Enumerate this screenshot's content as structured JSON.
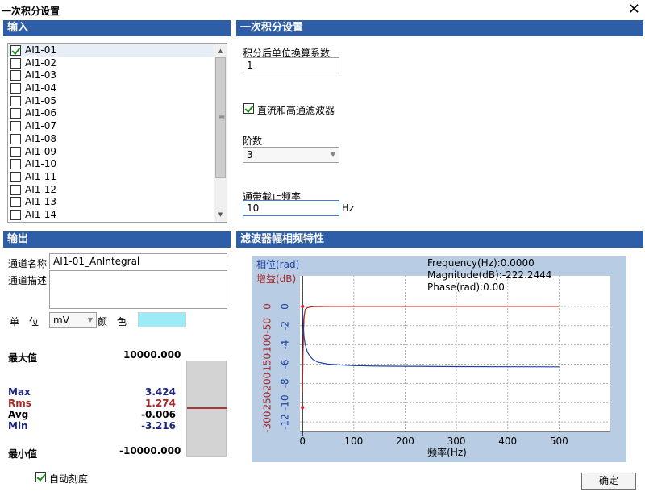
{
  "window": {
    "title": "一次积分设置",
    "close": "✕"
  },
  "input_section": {
    "header": "输入",
    "channels": [
      {
        "label": "AI1-01",
        "checked": true
      },
      {
        "label": "AI1-02",
        "checked": false
      },
      {
        "label": "AI1-03",
        "checked": false
      },
      {
        "label": "AI1-04",
        "checked": false
      },
      {
        "label": "AI1-05",
        "checked": false
      },
      {
        "label": "AI1-06",
        "checked": false
      },
      {
        "label": "AI1-07",
        "checked": false
      },
      {
        "label": "AI1-08",
        "checked": false
      },
      {
        "label": "AI1-09",
        "checked": false
      },
      {
        "label": "AI1-10",
        "checked": false
      },
      {
        "label": "AI1-11",
        "checked": false
      },
      {
        "label": "AI1-12",
        "checked": false
      },
      {
        "label": "AI1-13",
        "checked": false
      },
      {
        "label": "AI1-14",
        "checked": false
      }
    ]
  },
  "settings": {
    "header": "一次积分设置",
    "coef_label": "积分后单位换算系数",
    "coef_value": "1",
    "filter_label": "直流和高通滤波器",
    "filter_checked": true,
    "order_label": "阶数",
    "order_value": "3",
    "cutoff_label": "通带截止频率",
    "cutoff_value": "10",
    "cutoff_unit": "Hz"
  },
  "output": {
    "header": "输出",
    "name_label": "通道名称",
    "name_value": "AI1-01_AnIntegral",
    "desc_label": "通道描述",
    "desc_value": "",
    "unit_label": "单　位",
    "unit_value": "mV",
    "color_label": "颜　色",
    "color_value": "#9cecf8",
    "max_label": "最大值",
    "max_value": "10000.000",
    "min_label": "最小值",
    "min_value": "-10000.000",
    "stats": [
      {
        "label": "Max",
        "value": "3.424",
        "color": "#1a237e"
      },
      {
        "label": "Rms",
        "value": "1.274",
        "color": "#a52a2a"
      },
      {
        "label": "Avg",
        "value": "-0.006",
        "color": "#000000"
      },
      {
        "label": "Min",
        "value": "-3.216",
        "color": "#1a237e"
      }
    ],
    "auto_scale_label": "自动刻度",
    "auto_scale_checked": true
  },
  "chart_data": {
    "type": "line",
    "header": "滤波器幅相频特性",
    "xlabel": "频率(Hz)",
    "ylabel_phase": "相位(rad)",
    "ylabel_gain": "增益(dB)",
    "xlim": [
      -5,
      600
    ],
    "x_ticks": [
      0,
      100,
      200,
      300,
      400,
      500
    ],
    "phase_ylim": [
      -13,
      1
    ],
    "phase_ticks": [
      0,
      -2,
      -4,
      -6,
      -8,
      -10,
      -12
    ],
    "gain_ylim": [
      -325,
      25
    ],
    "gain_ticks": [
      0,
      -50,
      -100,
      -150,
      -200,
      -250,
      -300
    ],
    "readout": {
      "frequency": "Frequency(Hz):0.0000",
      "magnitude": "Magnitude(dB):-222.2444",
      "phase": "Phase(rad):0.00"
    },
    "series": [
      {
        "axis": "gain",
        "color": "#b22222",
        "x": [
          0,
          1,
          2,
          3,
          5,
          10,
          20,
          50,
          100,
          200,
          300,
          400,
          500
        ],
        "values": [
          -222,
          -120,
          -60,
          -30,
          -8,
          -3,
          -0.5,
          0,
          0,
          0,
          0,
          0,
          0
        ]
      },
      {
        "axis": "phase",
        "color": "#1f3fa8",
        "x": [
          0,
          1,
          2,
          3,
          5,
          8,
          10,
          15,
          20,
          30,
          50,
          80,
          100,
          150,
          200,
          300,
          400,
          500
        ],
        "values": [
          0,
          -1.5,
          -2.5,
          -3.2,
          -3.9,
          -4.5,
          -4.8,
          -5.2,
          -5.5,
          -5.8,
          -6.0,
          -6.1,
          -6.15,
          -6.2,
          -6.22,
          -6.25,
          -6.27,
          -6.28
        ]
      }
    ],
    "markers": [
      {
        "axis": "gain",
        "x": 0,
        "y": 0,
        "color": "#e02020"
      },
      {
        "axis": "phase",
        "x": 0,
        "y": -10.5,
        "color": "#e02020"
      }
    ]
  },
  "ok_button": "确定"
}
